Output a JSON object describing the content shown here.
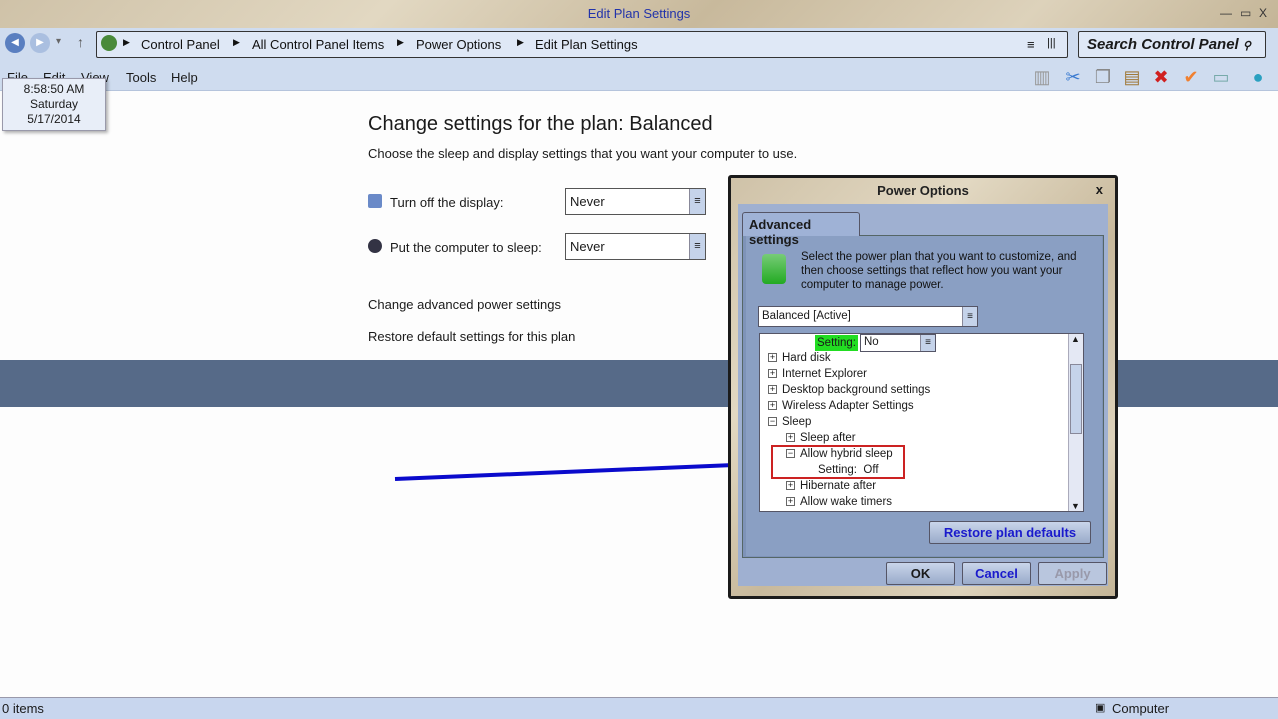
{
  "window": {
    "title": "Edit Plan Settings",
    "minimize": "—",
    "maximize": "▭",
    "close": "X"
  },
  "nav": {
    "back": "◀",
    "forward": "▶",
    "dropdown": "▾",
    "up": "↑"
  },
  "breadcrumb": [
    "Control Panel",
    "All Control Panel Items",
    "Power Options",
    "Edit Plan Settings"
  ],
  "search": {
    "placeholder": "Search Control Panel"
  },
  "menu": [
    "File",
    "Edit",
    "View",
    "Tools",
    "Help"
  ],
  "clock": {
    "time": "8:58:50 AM",
    "day": "Saturday",
    "date": "5/17/2014"
  },
  "main": {
    "heading": "Change settings for the plan: Balanced",
    "subheading": "Choose the sleep and display settings that you want your computer to use.",
    "display_label": "Turn off the display:",
    "display_value": "Never",
    "sleep_label": "Put the computer to sleep:",
    "sleep_value": "Never",
    "advanced_link": "Change advanced power settings",
    "restore_link": "Restore default settings for this plan"
  },
  "status": {
    "items": "0 items",
    "location": "Computer"
  },
  "dialog": {
    "title": "Power Options",
    "close": "x",
    "tab": "Advanced settings",
    "description": "Select the power plan that you want to customize, and then choose settings that reflect how you want your computer to manage power.",
    "plan": "Balanced [Active]",
    "setting_label": "Setting:",
    "setting_value": "No",
    "tree": [
      {
        "label": "Hard disk",
        "state": "+"
      },
      {
        "label": "Internet Explorer",
        "state": "+"
      },
      {
        "label": "Desktop background settings",
        "state": "+"
      },
      {
        "label": "Wireless Adapter Settings",
        "state": "+"
      },
      {
        "label": "Sleep",
        "state": "−"
      },
      {
        "label": "Sleep after",
        "state": "+"
      },
      {
        "label": "Allow hybrid sleep",
        "state": "−"
      },
      {
        "label": "Setting:  Off",
        "state": ""
      },
      {
        "label": "Hibernate after",
        "state": "+"
      },
      {
        "label": "Allow wake timers",
        "state": "+"
      }
    ],
    "restore_button": "Restore plan defaults",
    "ok": "OK",
    "cancel": "Cancel",
    "apply": "Apply"
  },
  "colors": {
    "highlight_green": "#22dd22",
    "annotation_red": "#cc2222",
    "arrow_blue": "#0a0acc",
    "band": "#566a88"
  }
}
